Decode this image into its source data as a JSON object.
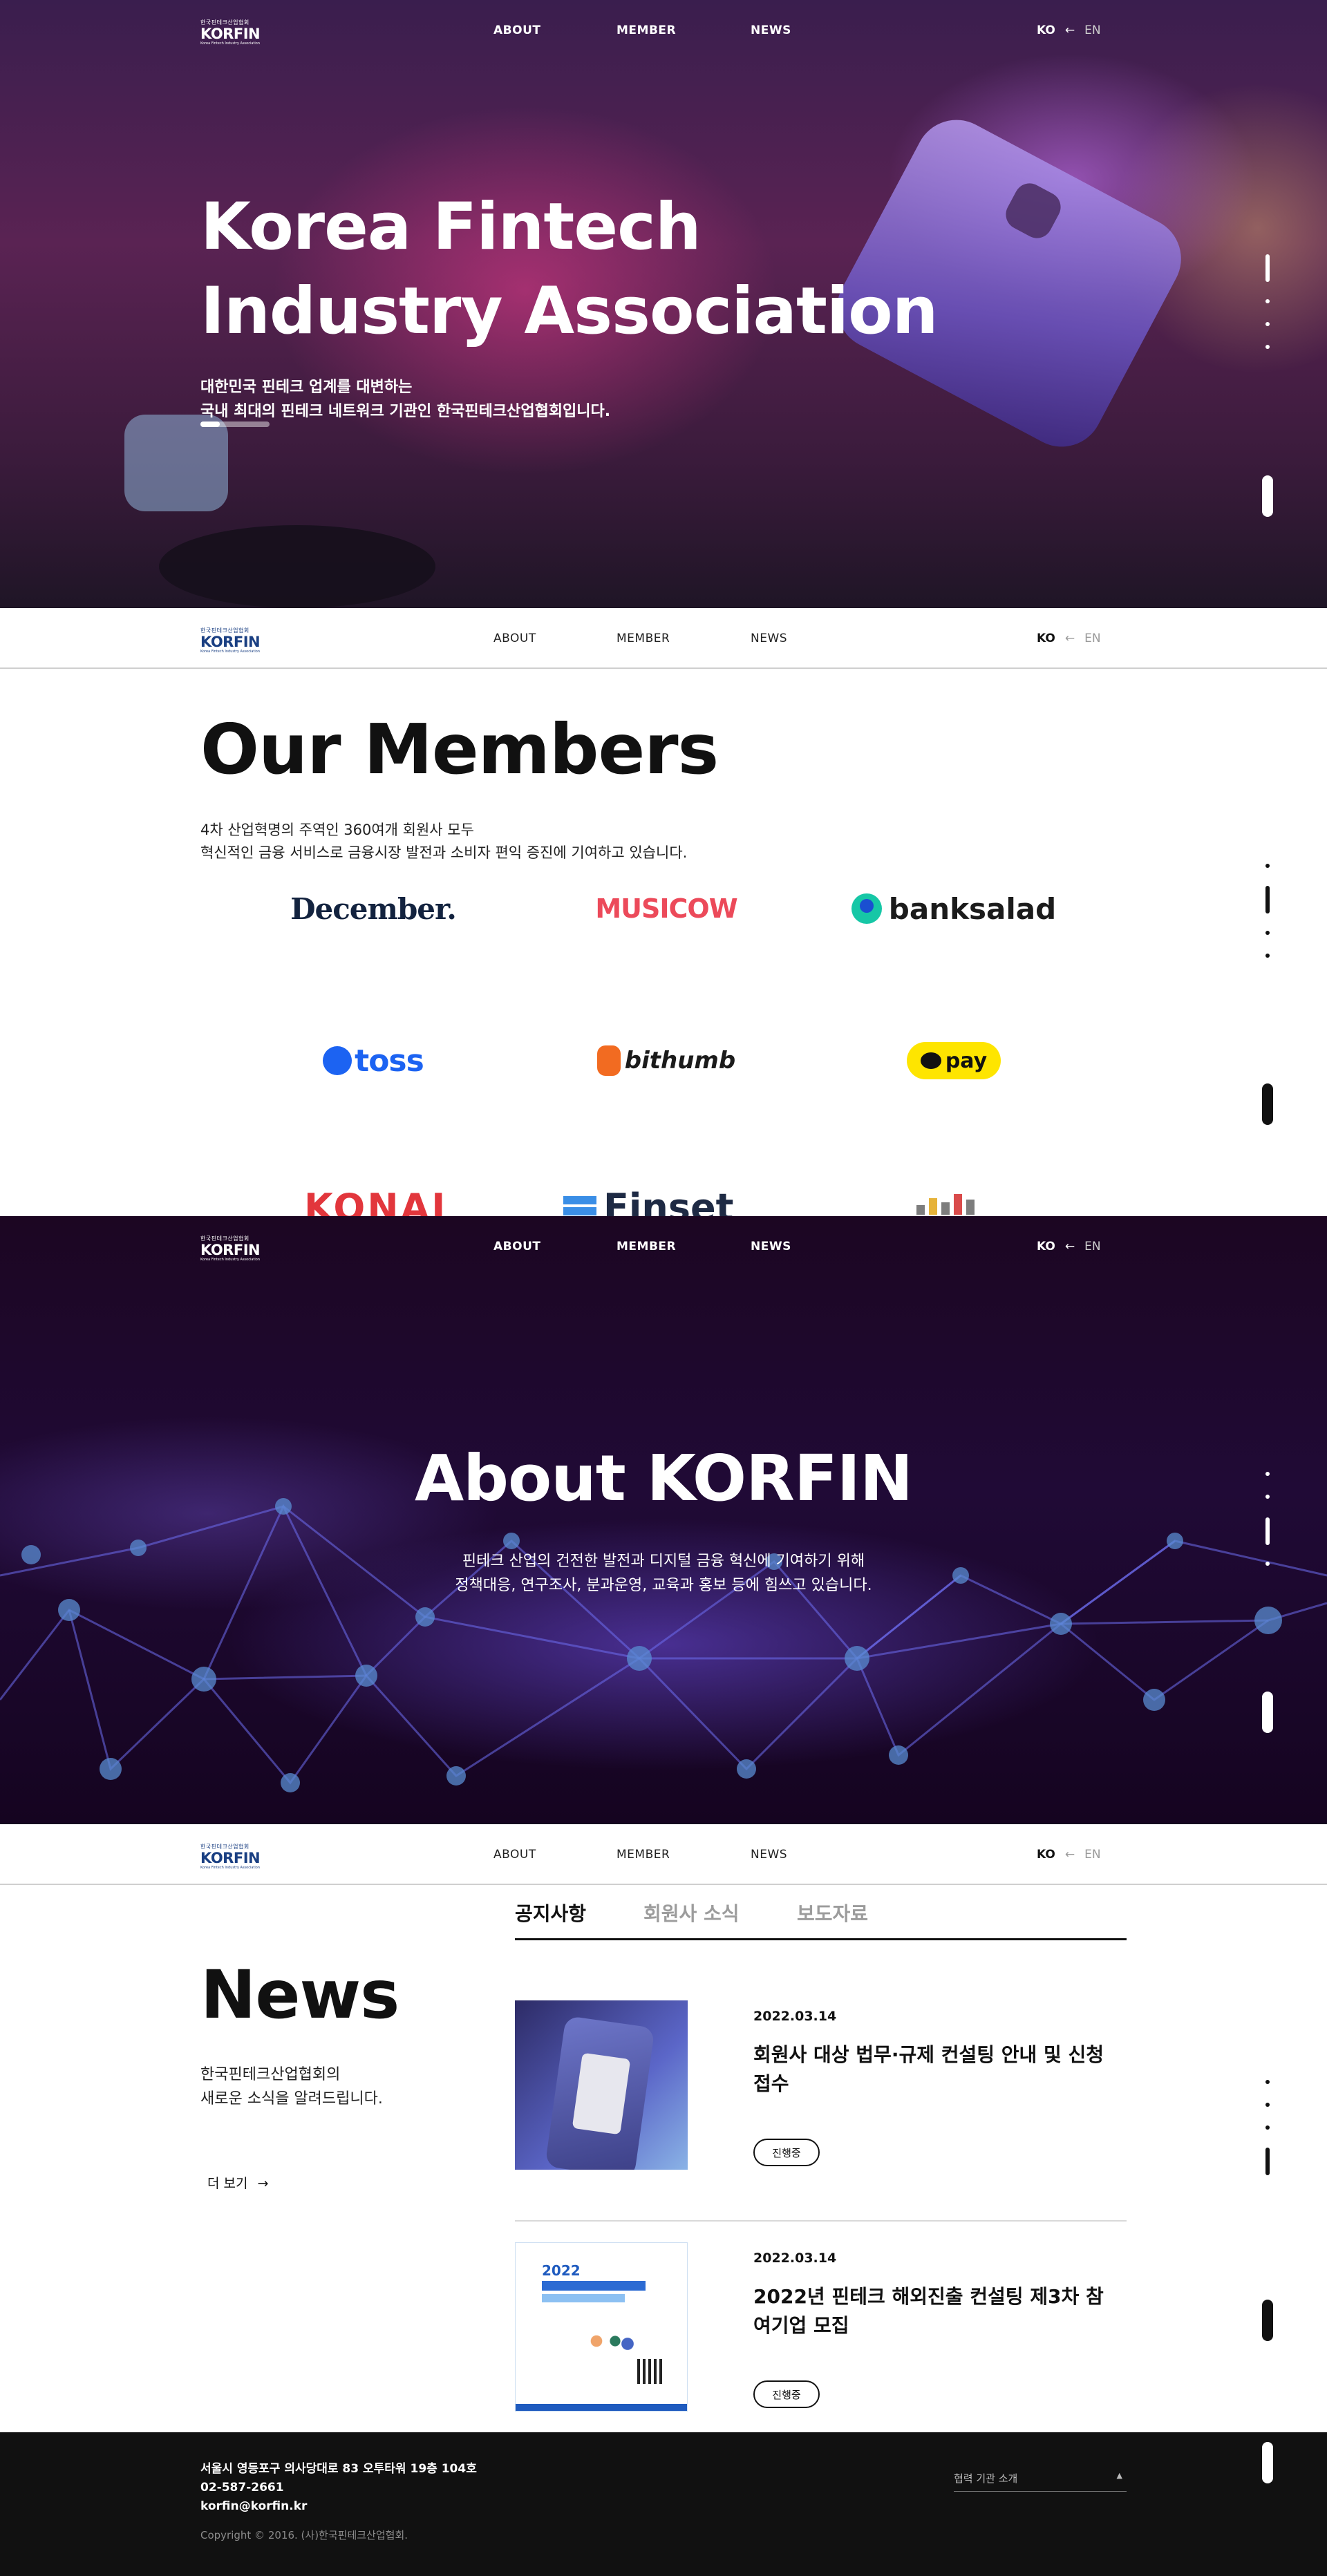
{
  "header": {
    "logo_small": "한국핀테크산업협회",
    "logo_main": "KORFIN",
    "logo_tag": "Korea Fintech Industry Association",
    "nav": [
      "ABOUT",
      "MEMBER",
      "NEWS"
    ],
    "lang_ko": "KO",
    "lang_arrow": "←",
    "lang_en": "EN"
  },
  "hero": {
    "title_line1": "Korea Fintech",
    "title_line2": "Industry Association",
    "sub_line1": "대한민국 핀테크 업계를 대변하는",
    "sub_line2": "국내 최대의 핀테크 네트워크 기관인 한국핀테크산업협회입니다.",
    "slide_progress": 0.28
  },
  "members": {
    "title": "Our Members",
    "desc_line1": "4차 산업혁명의 주역인 360여개 회원사 모두",
    "desc_line2": "혁신적인 금융 서비스로 금융시장 발전과 소비자 편익 증진에 기여하고 있습니다.",
    "logos": {
      "december": "December.",
      "musicow": "MUSICOW",
      "banksalad": "banksalad",
      "toss": "toss",
      "bithumb": "bithumb",
      "kakaopay": "pay",
      "konai": "KONAI",
      "finset": "Finset N"
    },
    "colors": {
      "toss": "#1c63f2",
      "musicow": "#ec4a5a",
      "kakaopay": "#fee500",
      "bithumb": "#f26b21"
    }
  },
  "about": {
    "title": "About KORFIN",
    "desc_line1": "핀테크 산업의 건전한 발전과 디지털 금융 혁신에 기여하기 위해",
    "desc_line2": "정책대응, 연구조사, 분과운영, 교육과 홍보 등에 힘쓰고 있습니다."
  },
  "news": {
    "title": "News",
    "desc_line1": "한국핀테크산업협회의",
    "desc_line2": "새로운 소식을 알려드립니다.",
    "more": "더 보기",
    "more_arrow": "→",
    "tabs": [
      "공지사항",
      "회원사 소식",
      "보도자료"
    ],
    "articles": [
      {
        "date": "2022.03.14",
        "headline": "회원사 대상 법무·규제 컨설팅 안내 및 신청 접수",
        "status": "진행중"
      },
      {
        "date": "2022.03.14",
        "headline": "2022년 핀테크 해외진출 컨설팅 제3차 참여기업 모집",
        "status": "진행중",
        "poster_year": "2022"
      }
    ]
  },
  "footer": {
    "address": "서울시 영등포구 의사당대로 83 오투타워 19층 104호",
    "phone": "02-587-2661",
    "email": "korfin@korfin.kr",
    "copyright": "Copyright © 2016. (사)한국핀테크산업협회.",
    "partner_select": "협력 기관 소개",
    "caret": "▲"
  }
}
